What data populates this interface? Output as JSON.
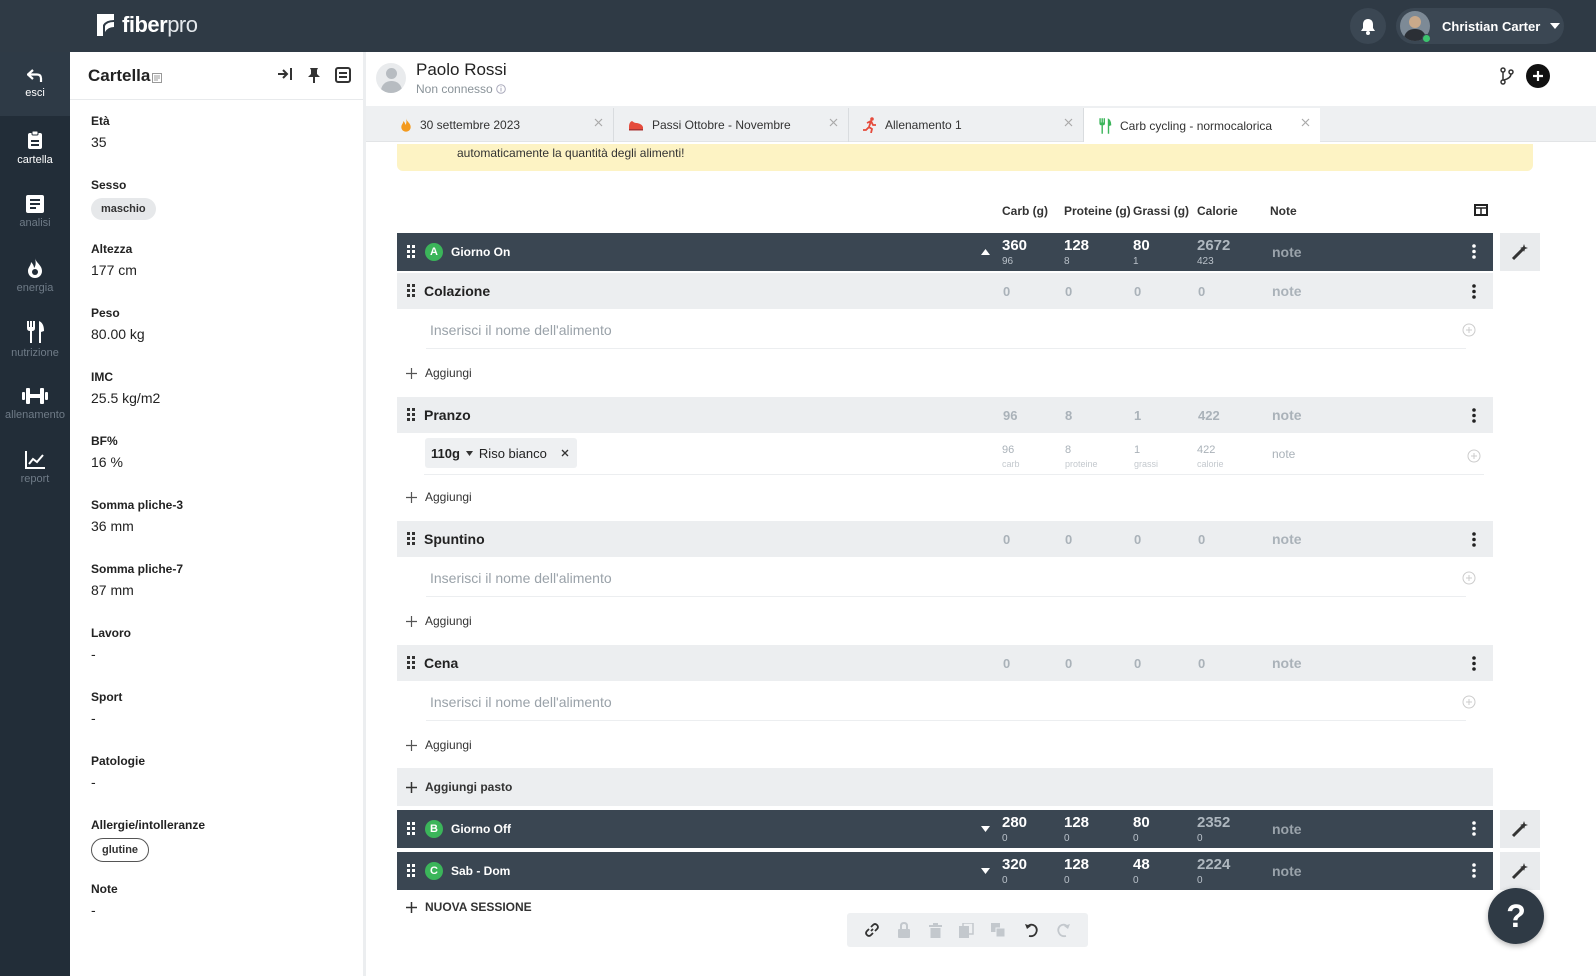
{
  "app": {
    "logo_main": "fiber",
    "logo_sub": "pro"
  },
  "user": {
    "name": "Christian Carter"
  },
  "nav": [
    {
      "label": "esci",
      "icon": "back-arrow-icon"
    },
    {
      "label": "cartella",
      "icon": "clipboard-icon"
    },
    {
      "label": "analisi",
      "icon": "document-icon"
    },
    {
      "label": "energia",
      "icon": "flame-icon"
    },
    {
      "label": "nutrizione",
      "icon": "cutlery-icon"
    },
    {
      "label": "allenamento",
      "icon": "dumbbell-icon"
    },
    {
      "label": "report",
      "icon": "chart-icon"
    }
  ],
  "panel": {
    "title": "Cartella",
    "fields": [
      {
        "label": "Età",
        "value": "35"
      },
      {
        "label": "Sesso",
        "chip": "maschio"
      },
      {
        "label": "Altezza",
        "value": "177 cm"
      },
      {
        "label": "Peso",
        "value": "80.00 kg"
      },
      {
        "label": "IMC",
        "value": "25.5 kg/m2"
      },
      {
        "label": "BF%",
        "value": "16 %"
      },
      {
        "label": "Somma pliche-3",
        "value": "36 mm"
      },
      {
        "label": "Somma pliche-7",
        "value": "87 mm"
      },
      {
        "label": "Lavoro",
        "value": "-"
      },
      {
        "label": "Sport",
        "value": "-"
      },
      {
        "label": "Patologie",
        "value": "-"
      },
      {
        "label": "Allergie/intolleranze",
        "chip": "glutine"
      },
      {
        "label": "Note",
        "value": "-"
      }
    ]
  },
  "patient": {
    "name": "Paolo Rossi",
    "status": "Non connesso"
  },
  "tabs": [
    {
      "label": "30 settembre 2023",
      "icon": "flame-icon"
    },
    {
      "label": "Passi Ottobre - Novembre",
      "icon": "shoe-icon"
    },
    {
      "label": "Allenamento 1",
      "icon": "runner-icon"
    },
    {
      "label": "Carb cycling - normocalorica",
      "icon": "cutlery-icon"
    }
  ],
  "banner": {
    "text": "automaticamente la quantità degli alimenti!"
  },
  "columns": {
    "carb": "Carb (g)",
    "protein": "Proteine (g)",
    "fat": "Grassi (g)",
    "calories": "Calorie",
    "note": "Note"
  },
  "days": [
    {
      "letter": "A",
      "name": "Giorno On",
      "carb": "360",
      "carb_sub": "96",
      "protein": "128",
      "protein_sub": "8",
      "fat": "80",
      "fat_sub": "1",
      "cal": "2672",
      "cal_sub": "423",
      "note": "note"
    },
    {
      "letter": "B",
      "name": "Giorno Off",
      "carb": "280",
      "carb_sub": "0",
      "protein": "128",
      "protein_sub": "0",
      "fat": "80",
      "fat_sub": "0",
      "cal": "2352",
      "cal_sub": "0",
      "note": "note"
    },
    {
      "letter": "C",
      "name": "Sab - Dom",
      "carb": "320",
      "carb_sub": "0",
      "protein": "128",
      "protein_sub": "0",
      "fat": "48",
      "fat_sub": "0",
      "cal": "2224",
      "cal_sub": "0",
      "note": "note"
    }
  ],
  "meals": [
    {
      "name": "Colazione",
      "carb": "0",
      "protein": "0",
      "fat": "0",
      "cal": "0",
      "note": "note"
    },
    {
      "name": "Pranzo",
      "carb": "96",
      "protein": "8",
      "fat": "1",
      "cal": "422",
      "note": "note"
    },
    {
      "name": "Spuntino",
      "carb": "0",
      "protein": "0",
      "fat": "0",
      "cal": "0",
      "note": "note"
    },
    {
      "name": "Cena",
      "carb": "0",
      "protein": "0",
      "fat": "0",
      "cal": "0",
      "note": "note"
    }
  ],
  "food_placeholder": "Inserisci il nome dell'alimento",
  "add_label": "Aggiungi",
  "food": {
    "qty": "110g",
    "name": "Riso bianco",
    "carb": "96",
    "carb_unit": "carb",
    "protein": "8",
    "protein_unit": "proteine",
    "fat": "1",
    "fat_unit": "grassi",
    "cal": "422",
    "cal_unit": "calorie",
    "note": "note"
  },
  "add_meal_label": "Aggiungi pasto",
  "new_session_label": "NUOVA SESSIONE",
  "help_label": "?",
  "colors": {
    "topbar": "#2f3a45",
    "sidebar": "#222d38",
    "day_row": "#3a4652",
    "accent_green": "#3bb55a",
    "banner": "#fdf3c4"
  }
}
